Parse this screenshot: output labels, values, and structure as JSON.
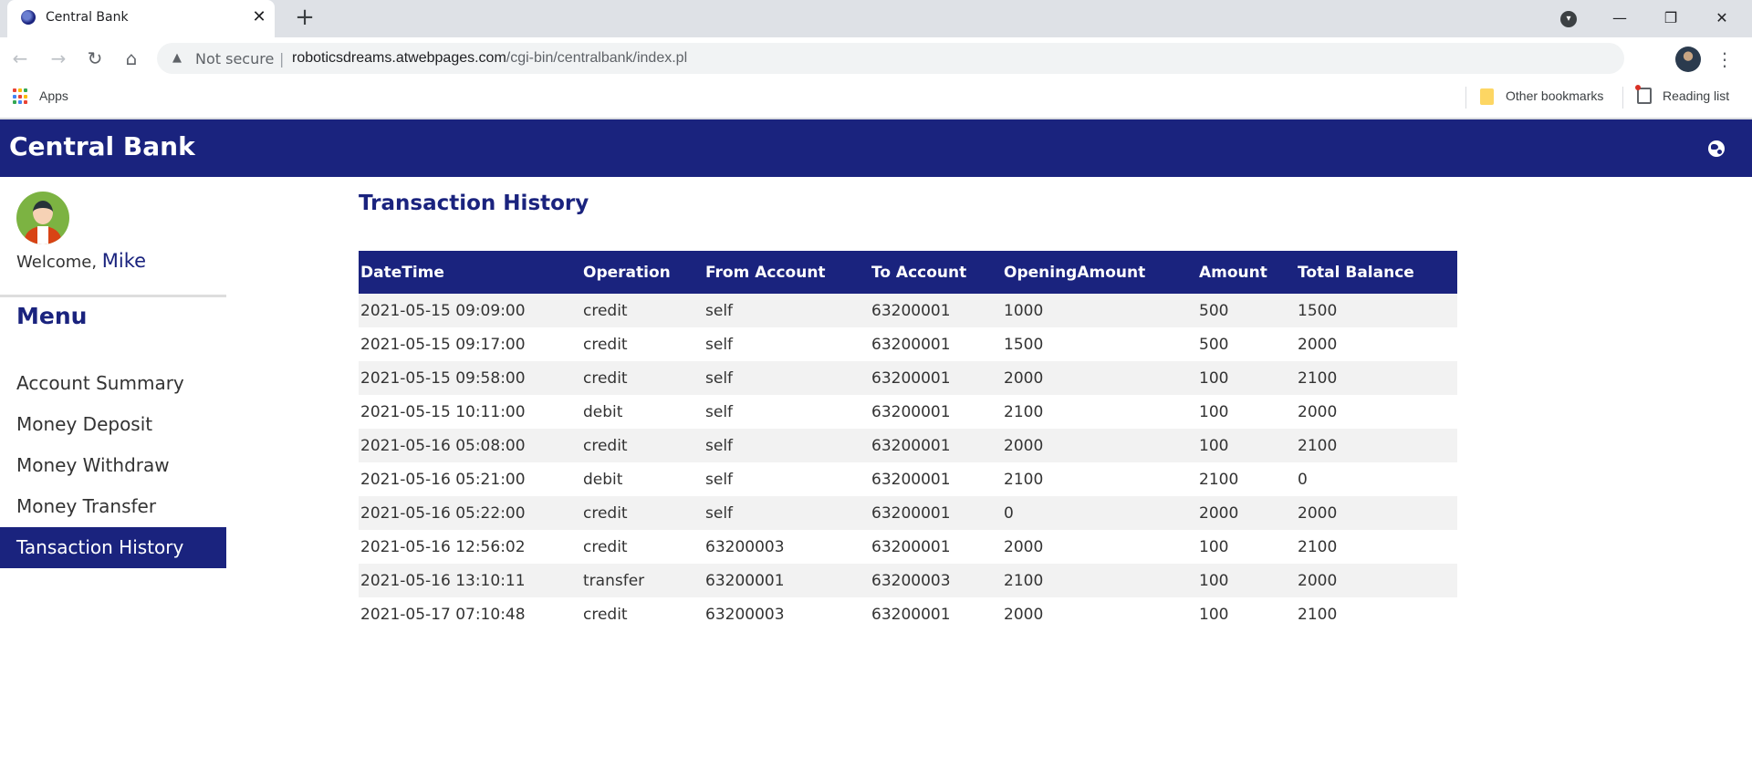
{
  "browser": {
    "tab_title": "Central Bank",
    "tab_close": "✕",
    "new_tab": "+",
    "omnibox": {
      "security_label": "Not secure",
      "separator": "|",
      "host": "roboticsdreams.atwebpages.com",
      "path": "/cgi-bin/centralbank/index.pl"
    },
    "bookmarks": {
      "apps_label": "Apps",
      "other_label": "Other bookmarks",
      "reading_list_label": "Reading list"
    }
  },
  "header": {
    "brand": "Central Bank",
    "brand_color": "#1a237e"
  },
  "sidebar": {
    "welcome_prefix": "Welcome,",
    "username": "Mike",
    "menu_title": "Menu",
    "items": [
      {
        "label": "Account Summary",
        "active": false
      },
      {
        "label": "Money Deposit",
        "active": false
      },
      {
        "label": "Money Withdraw",
        "active": false
      },
      {
        "label": "Money Transfer",
        "active": false
      },
      {
        "label": "Tansaction History",
        "active": true
      }
    ]
  },
  "main": {
    "title": "Transaction History",
    "columns": [
      "DateTime",
      "Operation",
      "From Account",
      "To Account",
      "OpeningAmount",
      "Amount",
      "Total Balance"
    ],
    "rows": [
      [
        "2021-05-15 09:09:00",
        "credit",
        "self",
        "63200001",
        "1000",
        "500",
        "1500"
      ],
      [
        "2021-05-15 09:17:00",
        "credit",
        "self",
        "63200001",
        "1500",
        "500",
        "2000"
      ],
      [
        "2021-05-15 09:58:00",
        "credit",
        "self",
        "63200001",
        "2000",
        "100",
        "2100"
      ],
      [
        "2021-05-15 10:11:00",
        "debit",
        "self",
        "63200001",
        "2100",
        "100",
        "2000"
      ],
      [
        "2021-05-16 05:08:00",
        "credit",
        "self",
        "63200001",
        "2000",
        "100",
        "2100"
      ],
      [
        "2021-05-16 05:21:00",
        "debit",
        "self",
        "63200001",
        "2100",
        "2100",
        "0"
      ],
      [
        "2021-05-16 05:22:00",
        "credit",
        "self",
        "63200001",
        "0",
        "2000",
        "2000"
      ],
      [
        "2021-05-16 12:56:02",
        "credit",
        "63200003",
        "63200001",
        "2000",
        "100",
        "2100"
      ],
      [
        "2021-05-16 13:10:11",
        "transfer",
        "63200001",
        "63200003",
        "2100",
        "100",
        "2000"
      ],
      [
        "2021-05-17 07:10:48",
        "credit",
        "63200003",
        "63200001",
        "2000",
        "100",
        "2100"
      ]
    ]
  }
}
